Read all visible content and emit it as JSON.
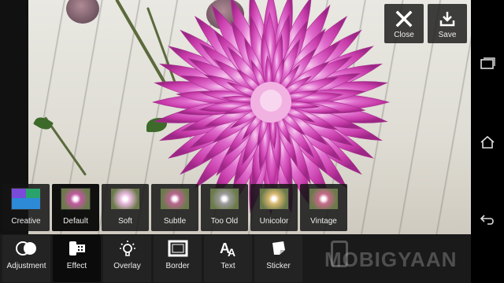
{
  "top_actions": {
    "close_label": "Close",
    "save_label": "Save"
  },
  "effects": [
    {
      "name": "Creative",
      "icon": "creative-grid-icon",
      "colors": [
        "#7a4ad8",
        "#2aa36a",
        "#d6c62c",
        "#2c8ad6"
      ]
    },
    {
      "name": "Default",
      "icon": "default-preview",
      "tint": "#c05aa0"
    },
    {
      "name": "Soft",
      "icon": "soft-preview",
      "tint": "#e8b8de"
    },
    {
      "name": "Subtle",
      "icon": "subtle-preview",
      "tint": "#b8648f"
    },
    {
      "name": "Too Old",
      "icon": "too-old-preview",
      "tint": "#9a9a9a"
    },
    {
      "name": "Unicolor",
      "icon": "unicolor-preview",
      "tint": "#d8b870"
    },
    {
      "name": "Vintage",
      "icon": "vintage-preview",
      "tint": "#c66a8a"
    }
  ],
  "selected_effect": "Default",
  "tools": [
    {
      "name": "Adjustment",
      "icon": "adjustment-icon"
    },
    {
      "name": "Effect",
      "icon": "film-roll-icon"
    },
    {
      "name": "Overlay",
      "icon": "lightbulb-icon"
    },
    {
      "name": "Border",
      "icon": "frame-icon"
    },
    {
      "name": "Text",
      "icon": "text-icon"
    },
    {
      "name": "Sticker",
      "icon": "sticker-icon"
    }
  ],
  "active_tool": "Effect",
  "watermark": "MOBIGYAAN",
  "colors": {
    "toolbar_bg": "#1a1a1a",
    "accent_flower": "#d24fb5"
  }
}
